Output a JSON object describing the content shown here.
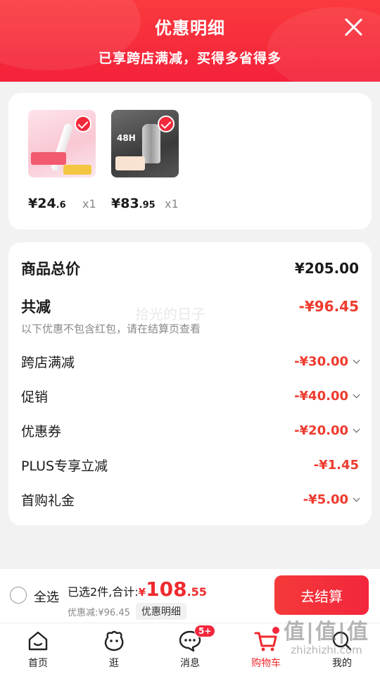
{
  "header": {
    "title": "优惠明细",
    "subtitle": "已享跨店满减，买得多省得多"
  },
  "products": [
    {
      "price_int": "¥24",
      "price_dec": ".6",
      "qty": "x1"
    },
    {
      "price_int": "¥83",
      "price_dec": ".95",
      "qty": "x1"
    }
  ],
  "summary": {
    "total_label": "商品总价",
    "total_value": "¥205.00",
    "reduce_label": "共减",
    "reduce_value": "-¥96.45",
    "note": "以下优惠不包含红包，请在结算页查看",
    "watermark": "拾光的日子",
    "items": [
      {
        "label": "跨店满减",
        "value": "-¥30.00",
        "expandable": true
      },
      {
        "label": "促销",
        "value": "-¥40.00",
        "expandable": true
      },
      {
        "label": "优惠券",
        "value": "-¥20.00",
        "expandable": true
      },
      {
        "label": "PLUS专享立减",
        "value": "-¥1.45",
        "expandable": false
      },
      {
        "label": "首购礼金",
        "value": "-¥5.00",
        "expandable": true
      }
    ]
  },
  "checkout": {
    "select_all": "全选",
    "selected_text": "已选2件,合计:",
    "total_currency": "¥",
    "total_int": "108",
    "total_dec": ".55",
    "discount_text": "优惠减:¥96.45",
    "detail_btn": "优惠明细",
    "checkout_btn": "去结算"
  },
  "tabs": [
    {
      "label": "首页",
      "icon": "home-icon"
    },
    {
      "label": "逛",
      "icon": "face-icon"
    },
    {
      "label": "消息",
      "icon": "message-icon",
      "badge": "5+"
    },
    {
      "label": "购物车",
      "icon": "cart-icon",
      "active": true
    },
    {
      "label": "我的",
      "icon": "profile-icon"
    }
  ],
  "site_logo": {
    "text": "值|值|值",
    "url_text": "zhizhizhi.com"
  },
  "colors": {
    "brand_red": "#f3263c",
    "discount_red": "#ee3a2e"
  }
}
